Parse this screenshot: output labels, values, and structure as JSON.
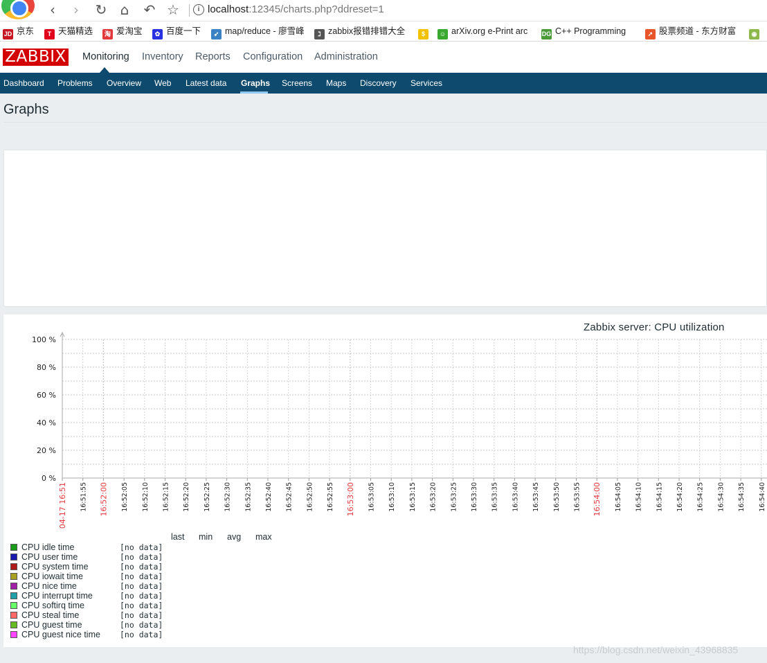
{
  "browser": {
    "url_host": "localhost",
    "url_rest": ":12345/charts.php?ddreset=1",
    "bookmarks": [
      {
        "label": "京东",
        "icon": "jd-icon",
        "color": "#c81623",
        "glyph": "JD"
      },
      {
        "label": "天猫精选",
        "icon": "tmall-icon",
        "color": "#e1001b",
        "glyph": "T"
      },
      {
        "label": "爱淘宝",
        "icon": "taobao-icon",
        "color": "#e4393c",
        "glyph": "淘"
      },
      {
        "label": "百度一下",
        "icon": "baidu-icon",
        "color": "#2932e1",
        "glyph": "✿"
      },
      {
        "label": "map/reduce - 廖雪峰",
        "icon": "rocket-icon",
        "color": "#3b82c4",
        "glyph": "➶"
      },
      {
        "label": "zabbix报错排错大全",
        "icon": "zabbix-bm-icon",
        "color": "#555555",
        "glyph": "ℷ"
      },
      {
        "label": "",
        "icon": "coin-icon",
        "color": "#f2c200",
        "glyph": "$"
      },
      {
        "label": "arXiv.org e-Print arc",
        "icon": "smiley-icon",
        "color": "#3aa82e",
        "glyph": "☺"
      },
      {
        "label": "C++ Programming",
        "icon": "dg-icon",
        "color": "#4a9a3a",
        "glyph": "DG"
      },
      {
        "label": "股票频道 - 东方财富",
        "icon": "eastmoney-icon",
        "color": "#e8552b",
        "glyph": "➚"
      },
      {
        "label": "",
        "icon": "book-icon",
        "color": "#8cb84c",
        "glyph": "◉"
      }
    ]
  },
  "zabbix": {
    "logo": "ZABBIX",
    "top_menu": [
      "Monitoring",
      "Inventory",
      "Reports",
      "Configuration",
      "Administration"
    ],
    "sub_menu": [
      "Dashboard",
      "Problems",
      "Overview",
      "Web",
      "Latest data",
      "Graphs",
      "Screens",
      "Maps",
      "Discovery",
      "Services"
    ],
    "active_top": "Monitoring",
    "active_sub": "Graphs",
    "page_title": "Graphs",
    "colors": {
      "brand": "#d40000",
      "nav_bg": "#0e4a6e",
      "accent": "#8ec8f0"
    }
  },
  "graph": {
    "title": "Zabbix server: CPU utilization",
    "legend_headers": [
      "last",
      "min",
      "avg",
      "max"
    ],
    "legend": [
      {
        "name": "CPU idle time",
        "color": "#1a9c1a",
        "value": "[no data]"
      },
      {
        "name": "CPU user time",
        "color": "#1a1ab0",
        "value": "[no data]"
      },
      {
        "name": "CPU system time",
        "color": "#b01a1a",
        "value": "[no data]"
      },
      {
        "name": "CPU iowait time",
        "color": "#a8a020",
        "value": "[no data]"
      },
      {
        "name": "CPU nice time",
        "color": "#a020a8",
        "value": "[no data]"
      },
      {
        "name": "CPU interrupt time",
        "color": "#20a0a8",
        "value": "[no data]"
      },
      {
        "name": "CPU softirq time",
        "color": "#66ff66",
        "value": "[no data]"
      },
      {
        "name": "CPU steal time",
        "color": "#ff6666",
        "value": "[no data]"
      },
      {
        "name": "CPU guest time",
        "color": "#66bb22",
        "value": "[no data]"
      },
      {
        "name": "CPU guest nice time",
        "color": "#ff44ff",
        "value": "[no data]"
      }
    ]
  },
  "chart_data": {
    "type": "line",
    "title": "Zabbix server: CPU utilization",
    "yticks": [
      "0 %",
      "20 %",
      "40 %",
      "60 %",
      "80 %",
      "100 %"
    ],
    "ylim": [
      0,
      100
    ],
    "xticks": [
      {
        "label": "04-17 16:51",
        "major": true
      },
      {
        "label": "16:51:55",
        "major": false
      },
      {
        "label": "16:52:00",
        "major": true
      },
      {
        "label": "16:52:05",
        "major": false
      },
      {
        "label": "16:52:10",
        "major": false
      },
      {
        "label": "16:52:15",
        "major": false
      },
      {
        "label": "16:52:20",
        "major": false
      },
      {
        "label": "16:52:25",
        "major": false
      },
      {
        "label": "16:52:30",
        "major": false
      },
      {
        "label": "16:52:35",
        "major": false
      },
      {
        "label": "16:52:40",
        "major": false
      },
      {
        "label": "16:52:45",
        "major": false
      },
      {
        "label": "16:52:50",
        "major": false
      },
      {
        "label": "16:52:55",
        "major": false
      },
      {
        "label": "16:53:00",
        "major": true
      },
      {
        "label": "16:53:05",
        "major": false
      },
      {
        "label": "16:53:10",
        "major": false
      },
      {
        "label": "16:53:15",
        "major": false
      },
      {
        "label": "16:53:20",
        "major": false
      },
      {
        "label": "16:53:25",
        "major": false
      },
      {
        "label": "16:53:30",
        "major": false
      },
      {
        "label": "16:53:35",
        "major": false
      },
      {
        "label": "16:53:40",
        "major": false
      },
      {
        "label": "16:53:45",
        "major": false
      },
      {
        "label": "16:53:50",
        "major": false
      },
      {
        "label": "16:53:55",
        "major": false
      },
      {
        "label": "16:54:00",
        "major": true
      },
      {
        "label": "16:54:05",
        "major": false
      },
      {
        "label": "16:54:10",
        "major": false
      },
      {
        "label": "16:54:15",
        "major": false
      },
      {
        "label": "16:54:20",
        "major": false
      },
      {
        "label": "16:54:25",
        "major": false
      },
      {
        "label": "16:54:30",
        "major": false
      },
      {
        "label": "16:54:35",
        "major": false
      },
      {
        "label": "16:54:40",
        "major": false
      }
    ],
    "series": [],
    "grid": true
  },
  "watermark": "https://blog.csdn.net/weixin_43968835"
}
